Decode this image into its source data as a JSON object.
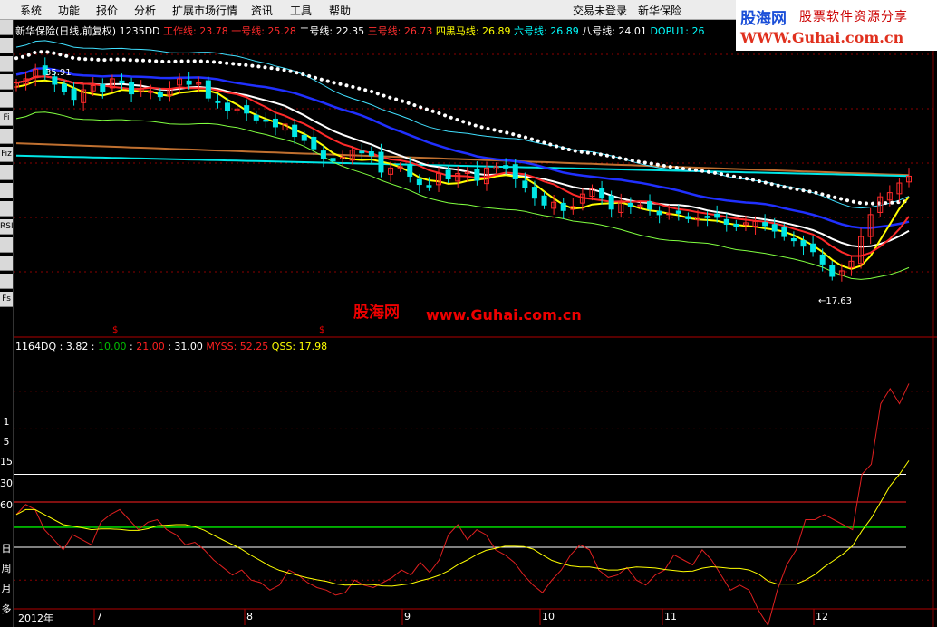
{
  "menu": {
    "items": [
      "系统",
      "功能",
      "报价",
      "分析",
      "扩展市场行情",
      "资讯",
      "工具",
      "帮助"
    ],
    "status": "交易未登录",
    "stock": "新华保险"
  },
  "logo": {
    "brand": "股海网",
    "slogan": "股票软件资源分享",
    "site": "WWW.Guhai.com.cn"
  },
  "watermark": {
    "cn": "股海网",
    "url": "www.Guhai.com.cn"
  },
  "main_legend": [
    {
      "text": "新华保险(日线,前复权) 1235DD ",
      "color": "#ffffff"
    },
    {
      "text": "工作线: 23.78 ",
      "color": "#ff2a2a"
    },
    {
      "text": "一号线: 25.28 ",
      "color": "#ff2a2a"
    },
    {
      "text": "二号线: 22.35 ",
      "color": "#ffffff"
    },
    {
      "text": "三号线: 26.73 ",
      "color": "#ff3030"
    },
    {
      "text": "四黑马线: 26.89 ",
      "color": "#ffff00"
    },
    {
      "text": "六号线: 26.89 ",
      "color": "#00ffff"
    },
    {
      "text": "八号线: 24.01 ",
      "color": "#ffffff"
    },
    {
      "text": "DOPU1: 26",
      "color": "#00ffff"
    }
  ],
  "sub_legend": [
    {
      "text": "1164DQ : 3.82 : ",
      "color": "#ffffff"
    },
    {
      "text": "10.00 ",
      "color": "#00c000"
    },
    {
      "text": ": ",
      "color": "#ffffff"
    },
    {
      "text": "21.00 ",
      "color": "#ff2020"
    },
    {
      "text": ": 31.00 ",
      "color": "#ffffff"
    },
    {
      "text": "MYSS: 52.25 ",
      "color": "#ff2020"
    },
    {
      "text": "QSS: 17.98",
      "color": "#ffff00"
    }
  ],
  "annotations": {
    "high": "35.91",
    "low": "17.63",
    "marker": "$"
  },
  "date_labels": [
    "2012年",
    "7",
    "8",
    "9",
    "10",
    "11",
    "12"
  ],
  "side_labels": [
    "1",
    "5",
    "15",
    "30",
    "60",
    "日",
    "周",
    "月",
    "多"
  ],
  "tools": [
    "",
    "",
    "",
    "",
    "",
    "Fi",
    "",
    "Fiz",
    "",
    "",
    "",
    "RSI",
    "",
    "",
    "",
    "Fs"
  ],
  "colors": {
    "up": "#ff2a2a",
    "down": "#00e6e6",
    "white": "#ffffff",
    "yellow": "#ffff00",
    "blue": "#2030ff",
    "cyan": "#00e6e6",
    "brown": "#c07030",
    "green": "#80ff40",
    "gridred": "#8b0000"
  },
  "chart_data": [
    {
      "type": "candlestick",
      "title": "新华保险(日线,前复权)",
      "note": "daily candles with moving-average overlays",
      "dates": [
        "2012年",
        "7",
        "8",
        "9",
        "10",
        "11",
        "12"
      ],
      "high_annotation": 35.91,
      "low_annotation": 17.63,
      "closes": [
        33.6,
        33.9,
        34.6,
        34.2,
        33.5,
        33.0,
        32.4,
        33.1,
        33.4,
        33.0,
        33.9,
        33.6,
        32.8,
        33.2,
        33.0,
        32.6,
        33.2,
        33.9,
        33.5,
        33.6,
        32.5,
        32.2,
        31.6,
        31.7,
        31.4,
        30.9,
        30.8,
        30.4,
        30.6,
        29.7,
        29.4,
        28.8,
        28.1,
        27.9,
        28.2,
        28.7,
        28.5,
        28.3,
        27.1,
        27.4,
        27.5,
        26.8,
        26.2,
        26.1,
        27.0,
        26.6,
        27.0,
        27.1,
        26.5,
        27.4,
        27.5,
        27.4,
        26.6,
        26.0,
        25.2,
        24.7,
        24.9,
        24.3,
        24.6,
        25.5,
        25.9,
        25.2,
        24.4,
        24.9,
        24.6,
        24.7,
        24.4,
        24.0,
        24.1,
        24.1,
        23.7,
        23.8,
        23.8,
        23.8,
        23.3,
        23.1,
        23.4,
        23.5,
        23.2,
        22.8,
        22.4,
        22.1,
        21.7,
        21.3,
        20.4,
        19.5,
        19.9,
        20.6,
        22.4,
        24.0,
        25.3,
        25.6,
        26.3,
        26.8
      ]
    },
    {
      "type": "line",
      "title": "1164DQ",
      "ylim": [
        0,
        100
      ],
      "levels": [
        10,
        21,
        31
      ],
      "series": [
        {
          "name": "MYSS",
          "last": 52.25
        },
        {
          "name": "QSS",
          "last": 17.98
        }
      ]
    }
  ]
}
